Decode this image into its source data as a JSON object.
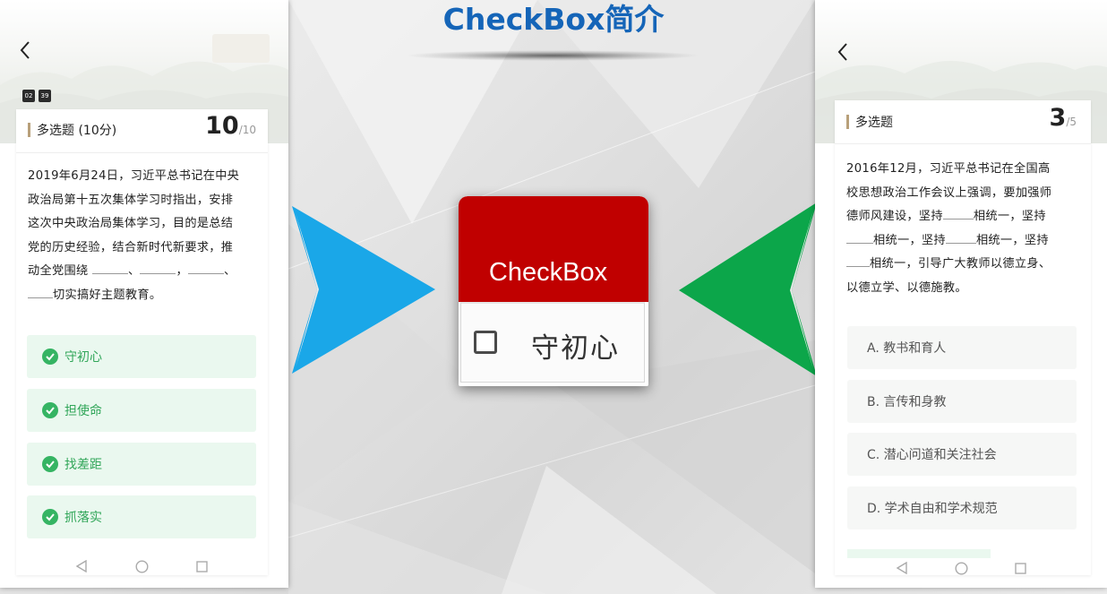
{
  "slide": {
    "title": "CheckBox简介",
    "title_color": "#1565b8"
  },
  "left_phone": {
    "back_icon": "chevron-left-icon",
    "timer": [
      "02",
      "39"
    ],
    "question": {
      "type": "多选题 (10分)",
      "number": "10",
      "total": "/10",
      "text": {
        "line1": "2019年6月24日，习近平总书记在中央",
        "line2": "政治局第十五次集体学习时指出，安排",
        "line3": "这次中央政治局集体学习，目的是总结",
        "line4": "党的历史经验，结合新时代新要求，推",
        "line5_start": "动全党围绕",
        "sep_comma": "、",
        "sep_comma2": "、",
        "sep_comma3": "，",
        "sep_comma4": "、",
        "line6_end": "切实搞好主题教育。"
      }
    },
    "options": [
      {
        "label": "守初心",
        "selected": true
      },
      {
        "label": "担使命",
        "selected": true
      },
      {
        "label": "找差距",
        "selected": true
      },
      {
        "label": "抓落实",
        "selected": true
      }
    ],
    "option_check_icon": "check-circle-icon",
    "selected_color": "#35b463"
  },
  "center": {
    "widget_title": "CheckBox",
    "checkbox_label": "守初心",
    "checkbox_checked": false,
    "header_color": "#c00000",
    "left_arrow_color": "#1aa7e8",
    "right_arrow_color": "#0ca64a",
    "left_arrow_icon": "chevron-right-arrow-icon",
    "right_arrow_icon": "chevron-left-arrow-icon"
  },
  "right_phone": {
    "back_icon": "chevron-left-icon",
    "question": {
      "type": "多选题",
      "number": "3",
      "total": "/5",
      "text": {
        "line1": "2016年12月，习近平总书记在全国高",
        "line2": "校思想政治工作会议上强调，要加强师",
        "line3_a": "德师风建设，坚持",
        "line3_b": "相统一，坚持",
        "line4_a": "相统一，坚持",
        "line4_b": "相统一，坚持",
        "line5": "相统一，引导广大教师以德立身、",
        "line6": "以德立学、以德施教。"
      }
    },
    "options": [
      {
        "label": "A. 教书和育人"
      },
      {
        "label": "B. 言传和身教"
      },
      {
        "label": "C. 潜心问道和关注社会"
      },
      {
        "label": "D. 学术自由和学术规范"
      }
    ]
  },
  "nav_icons": [
    "nav-back-icon",
    "nav-home-icon",
    "nav-recents-icon"
  ]
}
